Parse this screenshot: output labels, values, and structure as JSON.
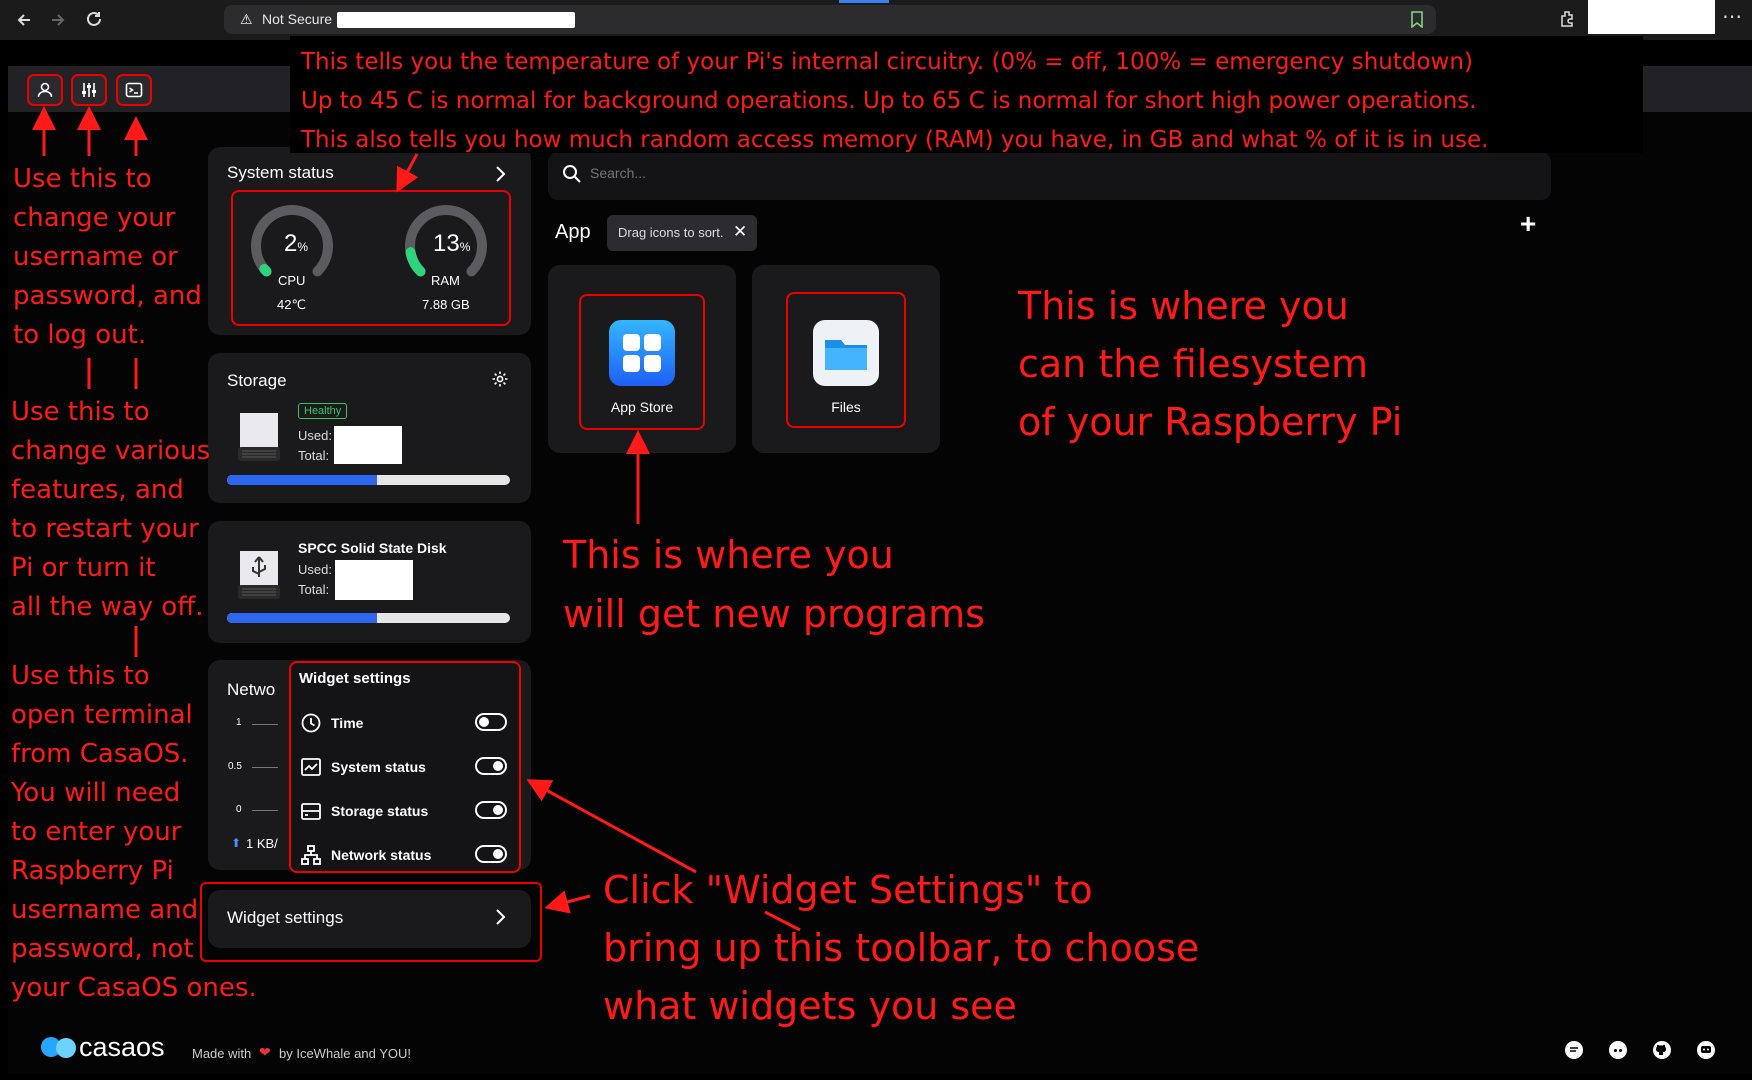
{
  "browser": {
    "security_label": "Not Secure"
  },
  "system_status": {
    "title": "System status",
    "cpu": {
      "percent": 2,
      "value": "2",
      "unit": "%",
      "label": "CPU",
      "temp": "42℃"
    },
    "ram": {
      "percent": 13,
      "value": "13",
      "unit": "%",
      "label": "RAM",
      "size": "7.88 GB"
    },
    "gauge_color": "#2fd37c"
  },
  "storage": {
    "title": "Storage",
    "badge": "Healthy",
    "used_label": "Used:",
    "total_label": "Total:",
    "usage_fraction": 0.53
  },
  "ssd": {
    "name": "SPCC Solid State Disk",
    "used_label": "Used:",
    "total_label": "Total:",
    "usage_fraction": 0.53
  },
  "network": {
    "title_partial": "Netwo",
    "ticks": [
      "1",
      "0.5",
      "0"
    ],
    "speed": "1 KB/"
  },
  "widget_settings_panel": {
    "title": "Widget settings",
    "items": [
      {
        "label": "Time",
        "enabled": false
      },
      {
        "label": "System status",
        "enabled": true
      },
      {
        "label": "Storage status",
        "enabled": true
      },
      {
        "label": "Network status",
        "enabled": true
      }
    ]
  },
  "widget_settings_button": {
    "label": "Widget settings"
  },
  "search": {
    "placeholder": "Search..."
  },
  "apps_section": {
    "title": "App",
    "hint": "Drag icons to sort.",
    "apps": [
      {
        "label": "App Store"
      },
      {
        "label": "Files"
      }
    ]
  },
  "footer": {
    "brand": "casaos",
    "made_with": "Made with",
    "by": "by IceWhale and YOU!"
  },
  "annotations": {
    "top_right": [
      "This tells you the temperature of your Pi's internal circuitry. (0% = off, 100% = emergency shutdown)",
      "Up to 45 C is normal for background operations. Up to 65 C is normal for short high power operations.",
      "This also tells you how much random access memory (RAM) you have, in GB and what % of it is in use."
    ],
    "left_1": [
      "Use this to",
      "change your",
      "username or",
      "password, and",
      "to log out."
    ],
    "left_2": [
      "Use this to",
      "change various",
      "features, and",
      "to restart your",
      "Pi or turn it",
      "all the way off."
    ],
    "left_3": [
      "Use this to",
      "open terminal",
      "from CasaOS.",
      "You will need",
      "to enter your",
      "Raspberry Pi",
      "username and",
      "password, not",
      "your CasaOS ones."
    ],
    "app_store": [
      "This is where you",
      "will get new programs"
    ],
    "files": [
      "This is where you",
      "can the filesystem",
      "of your Raspberry Pi"
    ],
    "widgets": [
      "Click \"Widget Settings\" to",
      "bring up this toolbar, to choose",
      "what widgets you see"
    ]
  }
}
